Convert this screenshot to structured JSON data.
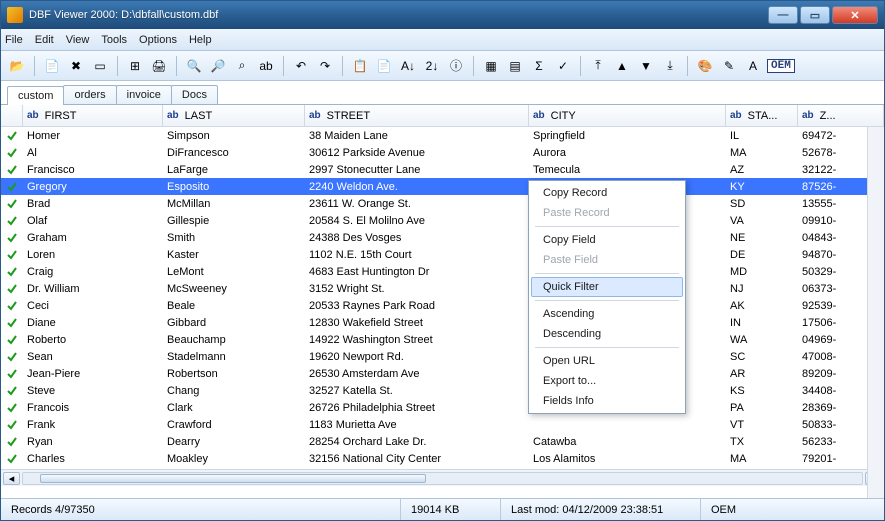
{
  "window": {
    "title": "DBF Viewer 2000: D:\\dbfall\\custom.dbf"
  },
  "menu": [
    "File",
    "Edit",
    "View",
    "Tools",
    "Options",
    "Help"
  ],
  "tabs": [
    "custom",
    "orders",
    "invoice",
    "Docs"
  ],
  "active_tab": 0,
  "columns": [
    {
      "prefix": "ab",
      "label": "FIRST"
    },
    {
      "prefix": "ab",
      "label": "LAST"
    },
    {
      "prefix": "ab",
      "label": "STREET"
    },
    {
      "prefix": "ab",
      "label": "CITY"
    },
    {
      "prefix": "ab",
      "label": "STA..."
    },
    {
      "prefix": "ab",
      "label": "Z..."
    }
  ],
  "rows": [
    {
      "first": "Homer",
      "last": "Simpson",
      "street": "38 Maiden Lane",
      "city": "Springfield",
      "state": "IL",
      "zip": "69472-"
    },
    {
      "first": "Al",
      "last": "DiFrancesco",
      "street": "30612 Parkside Avenue",
      "city": "Aurora",
      "state": "MA",
      "zip": "52678-"
    },
    {
      "first": "Francisco",
      "last": "LaFarge",
      "street": "2997 Stonecutter Lane",
      "city": "Temecula",
      "state": "AZ",
      "zip": "32122-"
    },
    {
      "first": "Gregory",
      "last": "Esposito",
      "street": "2240 Weldon Ave.",
      "city": "",
      "state": "KY",
      "zip": "87526-",
      "selected": true
    },
    {
      "first": "Brad",
      "last": "McMillan",
      "street": "23611 W. Orange St.",
      "city": "",
      "state": "SD",
      "zip": "13555-"
    },
    {
      "first": "Olaf",
      "last": "Gillespie",
      "street": "20584 S. El Molilno Ave",
      "city": "",
      "state": "VA",
      "zip": "09910-"
    },
    {
      "first": "Graham",
      "last": "Smith",
      "street": "24388 Des Vosges",
      "city": "",
      "state": "NE",
      "zip": "04843-"
    },
    {
      "first": "Loren",
      "last": "Kaster",
      "street": "1102 N.E. 15th Court",
      "city": "",
      "state": "DE",
      "zip": "94870-"
    },
    {
      "first": "Craig",
      "last": "LeMont",
      "street": "4683 East Huntington Dr",
      "city": "",
      "state": "MD",
      "zip": "50329-"
    },
    {
      "first": "Dr. William",
      "last": "McSweeney",
      "street": "3152 Wright St.",
      "city": "",
      "state": "NJ",
      "zip": "06373-"
    },
    {
      "first": "Ceci",
      "last": "Beale",
      "street": "20533 Raynes Park Road",
      "city": "",
      "state": "AK",
      "zip": "92539-"
    },
    {
      "first": "Diane",
      "last": "Gibbard",
      "street": "12830 Wakefield Street",
      "city": "",
      "state": "IN",
      "zip": "17506-"
    },
    {
      "first": "Roberto",
      "last": "Beauchamp",
      "street": "14922 Washington Street",
      "city": "",
      "state": "WA",
      "zip": "04969-"
    },
    {
      "first": "Sean",
      "last": "Stadelmann",
      "street": "19620 Newport Rd.",
      "city": "",
      "state": "SC",
      "zip": "47008-"
    },
    {
      "first": "Jean-Piere",
      "last": "Robertson",
      "street": "26530 Amsterdam Ave",
      "city": "",
      "state": "AR",
      "zip": "89209-"
    },
    {
      "first": "Steve",
      "last": "Chang",
      "street": "32527 Katella St.",
      "city": "",
      "state": "KS",
      "zip": "34408-"
    },
    {
      "first": "Francois",
      "last": "Clark",
      "street": "26726 Philadelphia Street",
      "city": "",
      "state": "PA",
      "zip": "28369-"
    },
    {
      "first": "Frank",
      "last": "Crawford",
      "street": "1183 Murietta Ave",
      "city": "",
      "state": "VT",
      "zip": "50833-"
    },
    {
      "first": "Ryan",
      "last": "Dearry",
      "street": "28254 Orchard Lake Dr.",
      "city": "Catawba",
      "state": "TX",
      "zip": "56233-"
    },
    {
      "first": "Charles",
      "last": "Moakley",
      "street": "32156 National City Center",
      "city": "Los Alamitos",
      "state": "MA",
      "zip": "79201-"
    }
  ],
  "context_menu": [
    {
      "label": "Copy Record"
    },
    {
      "label": "Paste Record",
      "disabled": true
    },
    {
      "sep": true
    },
    {
      "label": "Copy Field"
    },
    {
      "label": "Paste Field",
      "disabled": true
    },
    {
      "sep": true
    },
    {
      "label": "Quick Filter",
      "hover": true
    },
    {
      "sep": true
    },
    {
      "label": "Ascending"
    },
    {
      "label": "Descending"
    },
    {
      "sep": true
    },
    {
      "label": "Open URL"
    },
    {
      "label": "Export to..."
    },
    {
      "label": "Fields Info"
    }
  ],
  "status": {
    "records": "Records 4/97350",
    "size": "19014 KB",
    "lastmod": "Last mod: 04/12/2009 23:38:51",
    "mode": "OEM"
  },
  "toolbar_icons": [
    "open",
    "sep",
    "new",
    "delete",
    "row",
    "sep",
    "struct",
    "print",
    "sep",
    "find",
    "findnext",
    "seek",
    "replace",
    "sep",
    "undo",
    "redo",
    "sep",
    "copy",
    "paste",
    "sortaz",
    "sortdesc",
    "info",
    "sep",
    "table",
    "grid",
    "sum",
    "check",
    "sep",
    "top",
    "up",
    "down",
    "bottom",
    "sep",
    "palette",
    "paint",
    "font",
    "oem"
  ]
}
